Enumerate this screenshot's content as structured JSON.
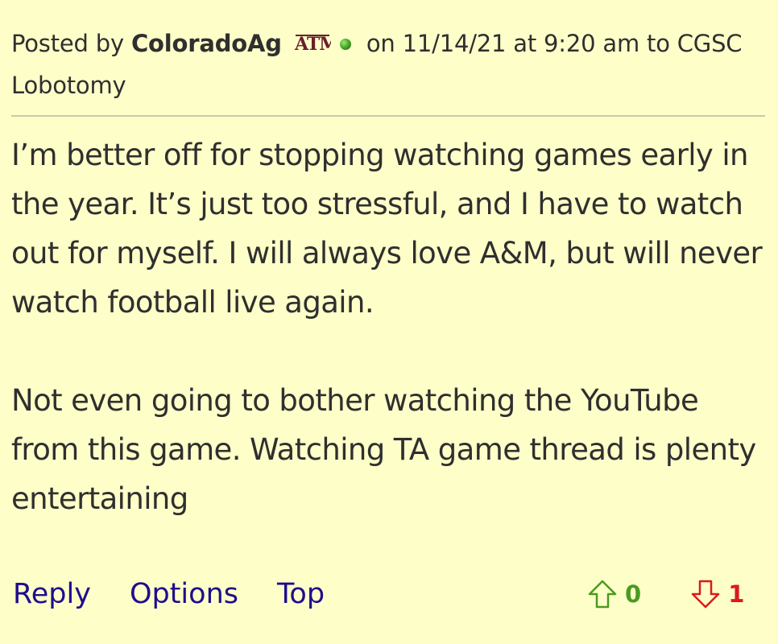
{
  "post": {
    "posted_by_prefix": "Posted by",
    "username": "ColoradoAg",
    "team_logo_text": "ATM",
    "posted_on": "on 11/14/21 at 9:20 am to CGSC Lobotomy",
    "paragraphs": [
      "I’m better off for stopping watching games early in the year. It’s just too stressful, and I have to watch out for myself. I will always love A&M, but will never watch football live again.",
      "Not even going to bother watching the YouTube from this game. Watching TA game thread is plenty entertaining"
    ]
  },
  "actions": {
    "reply": "Reply",
    "options": "Options",
    "top": "Top"
  },
  "votes": {
    "up_count": "0",
    "down_count": "1",
    "up_icon": "arrow-up-outline-icon",
    "down_icon": "arrow-down-outline-icon",
    "up_color": "#4a9b1f",
    "down_color": "#d91b1b"
  },
  "colors": {
    "background": "#fefec9",
    "link": "#1e0e8c",
    "text": "#2f2f2f",
    "team_maroon": "#6b1e2e",
    "online_dot": "#3f9e24"
  },
  "icons": {
    "team_logo": "texas-am-logo-icon",
    "status": "online-status-icon"
  }
}
